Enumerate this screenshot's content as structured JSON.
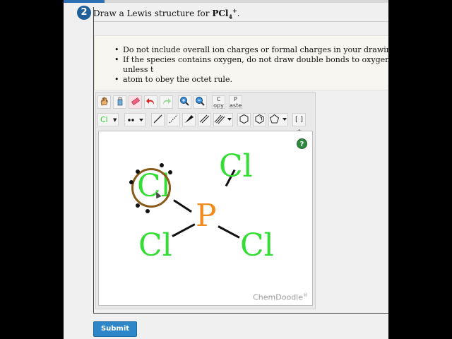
{
  "question": {
    "number": "2",
    "prefix": "Draw a Lewis structure for ",
    "formula": "PCl",
    "subscript": "4",
    "superscript": "+",
    "suffix": "."
  },
  "instructions": {
    "items": [
      "Do not include overall ion charges or formal charges in your drawing.",
      "If the species contains oxygen, do not draw double bonds to oxygen unless t",
      "atom to obey the octet rule."
    ]
  },
  "toolbar": {
    "copy_label": "C opy",
    "paste_label": "P aste",
    "element_label": "Cl",
    "charge_label": "[ ]±"
  },
  "molecule": {
    "atoms": [
      "Cl",
      "Cl",
      "P",
      "Cl",
      "Cl"
    ],
    "colors": {
      "chlorine": "#33dd33",
      "phosphorus": "#f28c1f",
      "highlight": "#8a5a1a"
    }
  },
  "editor": {
    "brand": "ChemDoodle",
    "brand_mark": "®",
    "help_label": "?"
  },
  "submit_label": "Submit"
}
